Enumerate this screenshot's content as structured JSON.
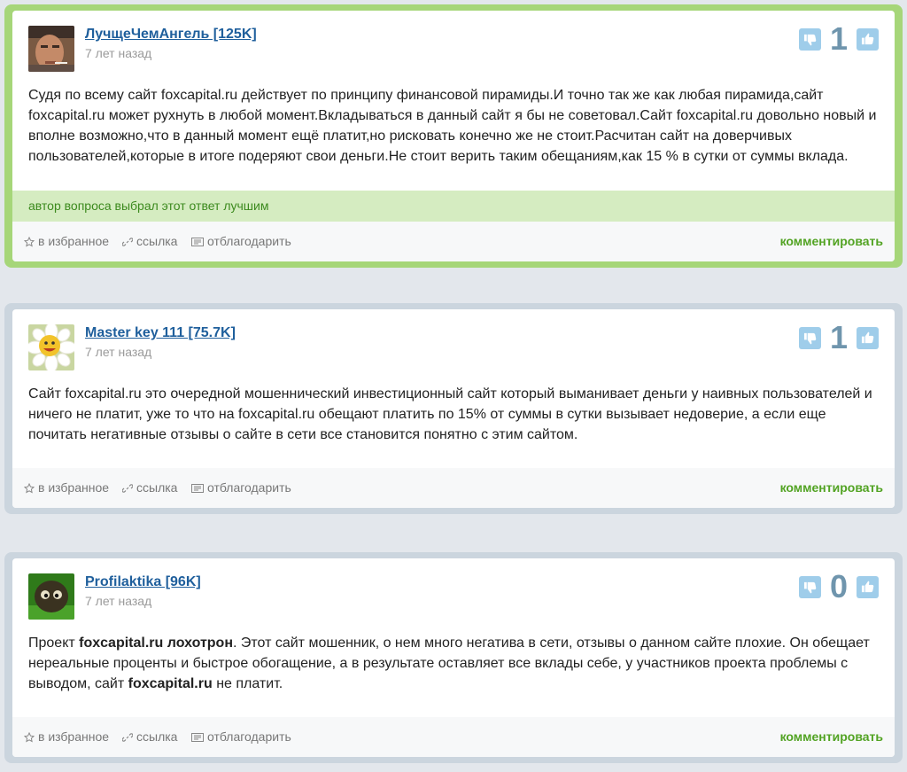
{
  "answers": [
    {
      "author": "ЛучщеЧемАнгель [125K]",
      "time": "7 лет назад",
      "votes": "1",
      "text": "Судя по всему сайт foxcapital.ru действует по принципу финансовой пирамиды.И точно так же как любая пирамида,сайт foxcapital.ru может рухнуть в любой момент.Вкладываться в данный сайт я бы не советовал.Сайт foxcapital.ru довольно новый и вполне возможно,что в данный момент ещё платит,но рисковать конечно же не стоит.Расчитан сайт на доверчивых пользователей,которые в итоге подеряют свои деньги.Не стоит верить таким обещаниям,как 15 % в сутки от суммы вклада.",
      "best_label": "автор вопроса выбрал этот ответ лучшим"
    },
    {
      "author": "Master key 111 [75.7K]",
      "time": "7 лет назад",
      "votes": "1",
      "text": "Сайт foxcapital.ru это очередной мошеннический инвестиционный сайт который выманивает деньги у наивных пользователей и ничего не платит, уже то что на foxcapital.ru обещают платить по 15% от суммы в сутки вызывает недоверие, а если еще почитать негативные отзывы о сайте в сети все становится понятно с этим сайтом."
    },
    {
      "author": "Profilaktika [96K]",
      "time": "7 лет назад",
      "votes": "0",
      "text_parts": [
        "Проект ",
        "foxcapital.ru лохотрон",
        ". Этот сайт мошенник, о нем много негатива в сети, отзывы о данном сайте плохие. Он обещает нереальные проценты и быстрое обогащение, а в результате оставляет все вклады себе, у участников проекта проблемы с выводом, сайт ",
        "foxcapital.ru",
        " не платит."
      ]
    }
  ],
  "footer": {
    "favorite": "в избранное",
    "link": "ссылка",
    "thank": "отблагодарить",
    "comment": "комментировать"
  },
  "icons": {
    "favorite": "star-icon",
    "link": "link-icon",
    "thank": "thank-icon",
    "dislike": "thumb-down-icon",
    "like": "thumb-up-icon"
  },
  "colors": {
    "best_border": "#a6d679",
    "normal_border": "#cbd5de",
    "author_link": "#1f5f9c",
    "comment_link": "#52a323",
    "vote_button": "#9fcdea"
  }
}
